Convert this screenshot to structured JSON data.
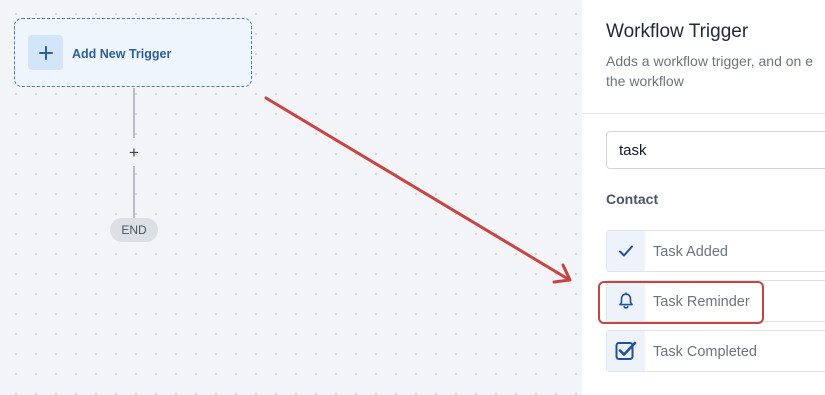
{
  "canvas": {
    "trigger_box": {
      "label": "Add New Trigger",
      "icon": "plus-icon"
    },
    "add_step": {
      "symbol": "+"
    },
    "end_node": {
      "label": "END"
    }
  },
  "panel": {
    "title": "Workflow Trigger",
    "description": "Adds a workflow trigger, and on e the workflow",
    "search": {
      "value": "task"
    },
    "section": "Contact",
    "options": [
      {
        "label": "Task Added",
        "icon": "checkmark-icon"
      },
      {
        "label": "Task Reminder",
        "icon": "bell-icon"
      },
      {
        "label": "Task Completed",
        "icon": "checkbox-checked-icon"
      }
    ]
  },
  "annotation": {
    "color": "#c84441",
    "highlighted_option": "Task Reminder"
  },
  "colors": {
    "accent": "#2b5f99",
    "icon_blue": "#1e4fa0",
    "canvas_bg": "#f2f4f7"
  }
}
